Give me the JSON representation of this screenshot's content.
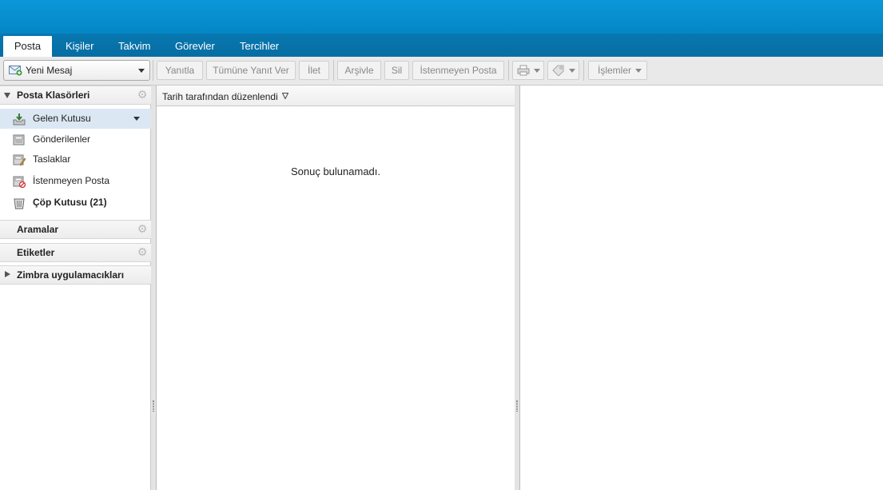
{
  "tabs": [
    "Posta",
    "Kişiler",
    "Takvim",
    "Görevler",
    "Tercihler"
  ],
  "toolbar": {
    "new_message": "Yeni Mesaj",
    "reply": "Yanıtla",
    "reply_all": "Tümüne Yanıt Ver",
    "forward": "İlet",
    "archive": "Arşivle",
    "delete": "Sil",
    "spam": "İstenmeyen Posta",
    "actions": "İşlemler"
  },
  "sidebar": {
    "folders_header": "Posta Klasörleri",
    "folders": [
      {
        "label": "Gelen Kutusu",
        "icon": "inbox-icon"
      },
      {
        "label": "Gönderilenler",
        "icon": "sent-icon"
      },
      {
        "label": "Taslaklar",
        "icon": "drafts-icon"
      },
      {
        "label": "İstenmeyen Posta",
        "icon": "junk-icon"
      },
      {
        "label": "Çöp Kutusu (21)",
        "icon": "trash-icon"
      }
    ],
    "searches_header": "Aramalar",
    "tags_header": "Etiketler",
    "zimlets_header": "Zimbra uygulamacıkları"
  },
  "list": {
    "sort_label": "Tarih tarafından düzenlendi",
    "empty_text": "Sonuç bulunamadı."
  }
}
